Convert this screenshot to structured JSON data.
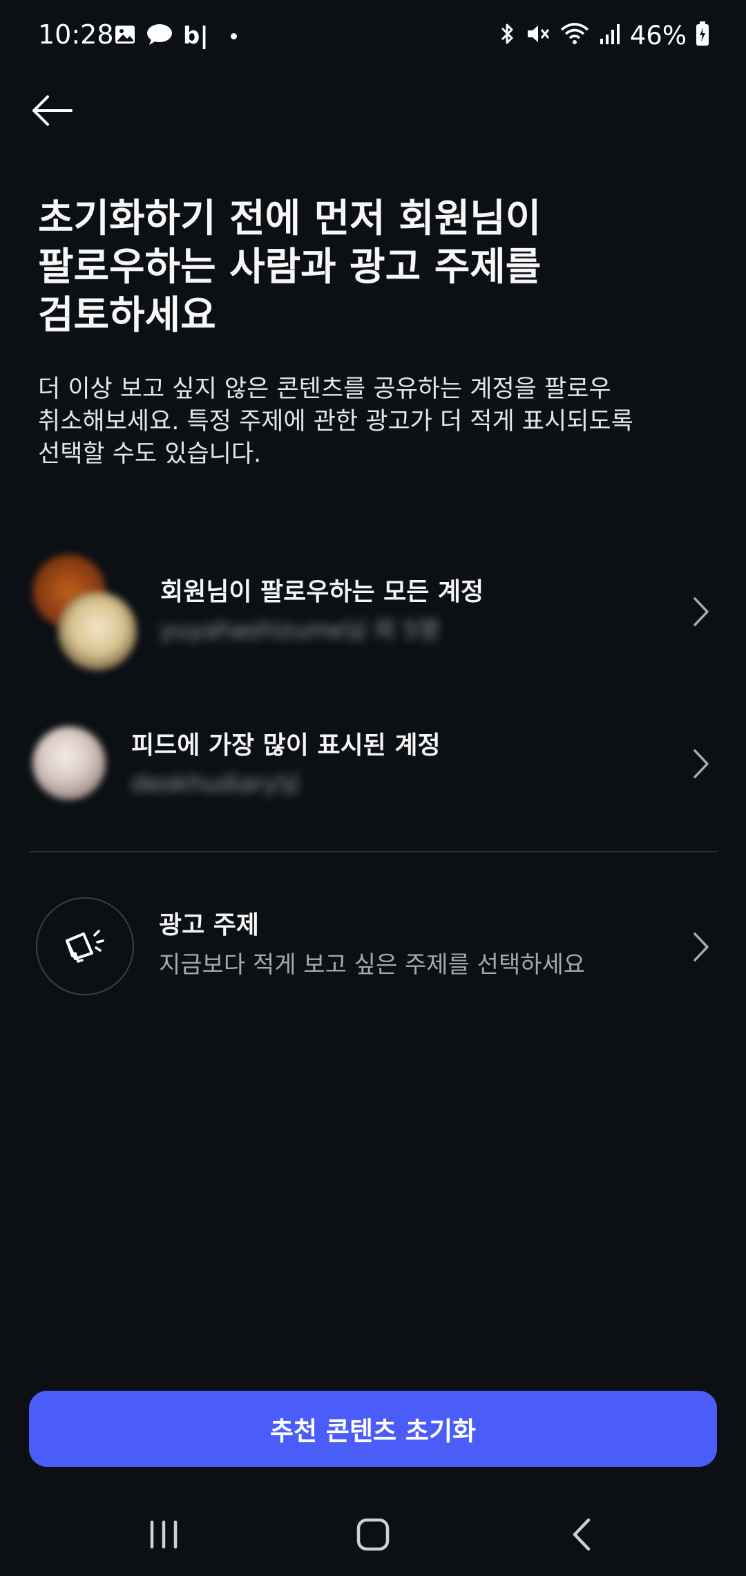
{
  "status_bar": {
    "time": "10:28",
    "app_text": "b|",
    "battery": "46%",
    "icons": [
      "gallery-icon",
      "thread-app-icon",
      "bluetooth-icon",
      "mute-icon",
      "wifi-icon",
      "signal-icon",
      "battery-icon"
    ]
  },
  "header": {
    "back_icon": "arrow-left-icon"
  },
  "main": {
    "title": "초기화하기 전에 먼저 회원님이\n팔로우하는 사람과 광고 주제를\n검토하세요",
    "description": "더 이상 보고 싶지 않은 콘텐츠를 공유하는 계정을 팔로우\n취소해보세요. 특정 주제에 관한 광고가 더 적게 표시되도록\n선택할 수도 있습니다."
  },
  "rows": [
    {
      "title": "회원님이 팔로우하는 모든 계정",
      "subtitle": "yuyahashizume님 외 5명",
      "icon": "chevron-right-icon"
    },
    {
      "title": "피드에 가장 많이 표시된 계정",
      "subtitle": "deokhudiary님",
      "icon": "chevron-right-icon"
    },
    {
      "title": "광고 주제",
      "subtitle": "지금보다 적게 보고 싶은 주제를 선택하세요",
      "icon": "megaphone-icon"
    }
  ],
  "footer": {
    "reset_button": "추천 콘텐츠 초기화"
  },
  "nav": {
    "icons": [
      "recent-apps-icon",
      "home-icon",
      "back-icon"
    ]
  },
  "colors": {
    "background": "#0c1014",
    "accent": "#4a5df9",
    "secondary_text": "#a8a8a8",
    "divider": "#2e3236"
  }
}
